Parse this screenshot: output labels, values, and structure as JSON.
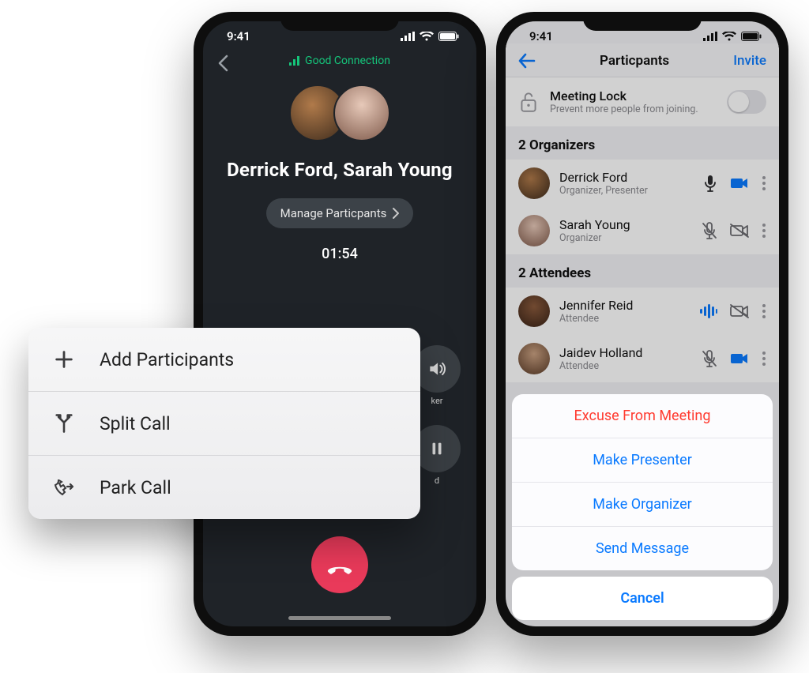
{
  "phoneA": {
    "statusbar": {
      "time": "9:41"
    },
    "connection_label": "Good Connection",
    "participants_line": "Derrick Ford,  Sarah Young",
    "manage_label": "Manage Particpants",
    "call_timer": "01:54",
    "speaker_label": "ker",
    "hold_label": "d"
  },
  "call_menu": {
    "add_participants": "Add Participants",
    "split_call": "Split Call",
    "park_call": "Park Call"
  },
  "phoneB": {
    "statusbar": {
      "time": "9:41"
    },
    "header_title": "Particpants",
    "invite_label": "Invite",
    "meeting_lock": {
      "title": "Meeting Lock",
      "subtitle": "Prevent more people from joining.",
      "on": false
    },
    "organizers_header": "2 Organizers",
    "attendees_header": "2 Attendees",
    "organizers": [
      {
        "name": "Derrick Ford",
        "role": "Organizer, Presenter",
        "mic": "on",
        "cam": "on"
      },
      {
        "name": "Sarah Young",
        "role": "Organizer",
        "mic": "muted",
        "cam": "off"
      }
    ],
    "attendees": [
      {
        "name": "Jennifer Reid",
        "role": "Attendee",
        "mic": "speaking",
        "cam": "off"
      },
      {
        "name": "Jaidev Holland",
        "role": "Attendee",
        "mic": "muted",
        "cam": "on"
      }
    ]
  },
  "action_sheet": {
    "excuse": "Excuse From Meeting",
    "make_presenter": "Make Presenter",
    "make_organizer": "Make Organizer",
    "send_message": "Send Message",
    "cancel": "Cancel"
  }
}
